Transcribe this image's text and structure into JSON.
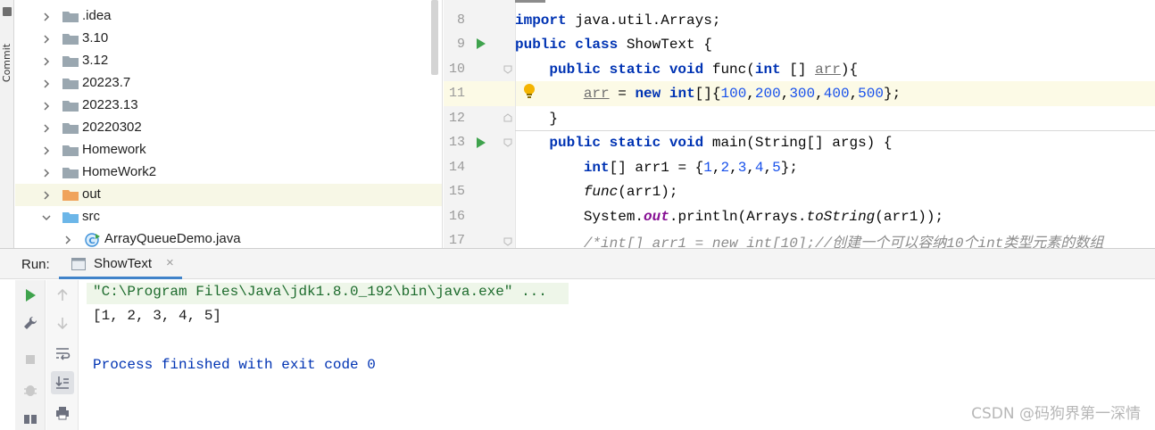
{
  "sidebar_strip": {
    "label": "Commit"
  },
  "project_tree": {
    "items": [
      {
        "label": ".idea",
        "type": "folder",
        "expanded": false
      },
      {
        "label": "3.10",
        "type": "folder",
        "expanded": false
      },
      {
        "label": "3.12",
        "type": "folder",
        "expanded": false
      },
      {
        "label": "20223.7",
        "type": "folder",
        "expanded": false
      },
      {
        "label": "20223.13",
        "type": "folder",
        "expanded": false
      },
      {
        "label": "20220302",
        "type": "folder",
        "expanded": false
      },
      {
        "label": "Homework",
        "type": "folder",
        "expanded": false
      },
      {
        "label": "HomeWork2",
        "type": "folder",
        "expanded": false
      },
      {
        "label": "out",
        "type": "folder-excluded",
        "expanded": false,
        "selected": true
      },
      {
        "label": "src",
        "type": "source-folder",
        "expanded": true
      },
      {
        "label": "ArrayQueueDemo.java",
        "type": "java-class",
        "expanded": false
      }
    ]
  },
  "editor": {
    "line_numbers": [
      "8",
      "9",
      "10",
      "11",
      "12",
      "13",
      "14",
      "15",
      "16",
      "17"
    ],
    "lines": {
      "l8": {
        "kw1": "import",
        "rest": " java.util.Arrays;"
      },
      "l9": {
        "kw1": "public class",
        "rest": " ShowText {"
      },
      "l10": {
        "indent": "    ",
        "kw1": "public static void",
        "mid": " func(",
        "kw2": "int",
        "mid2": " [] ",
        "param": "arr",
        "end": "){"
      },
      "l11": {
        "indent": "        ",
        "var": "arr",
        "eq": " = ",
        "kw1": "new",
        "sp": " ",
        "kw2": "int",
        "br": "[]{",
        "n1": "100",
        "n2": "200",
        "n3": "300",
        "n4": "400",
        "n5": "500",
        "close": "};",
        "comma": ","
      },
      "l12": {
        "indent": "    ",
        "text": "}"
      },
      "l13": {
        "indent": "    ",
        "kw1": "public static void",
        "rest": " main(String[] args) {"
      },
      "l14": {
        "indent": "        ",
        "kw1": "int",
        "mid": "[] arr1 = {",
        "n1": "1",
        "n2": "2",
        "n3": "3",
        "n4": "4",
        "n5": "5",
        "close": "};",
        "comma": ","
      },
      "l15": {
        "indent": "        ",
        "fn": "func",
        "rest": "(arr1);"
      },
      "l16": {
        "indent": "        ",
        "pre": "System.",
        "field": "out",
        "mid": ".println(Arrays.",
        "fn": "toString",
        "rest": "(arr1));"
      },
      "l17": {
        "indent": "        ",
        "comment": "/*int[] arr1 = new int[10];//创建一个可以容纳10个int类型元素的数组"
      }
    }
  },
  "run_panel": {
    "title": "Run:",
    "tab_label": "ShowText",
    "tab_close": "×",
    "console": {
      "command": "\"C:\\Program Files\\Java\\jdk1.8.0_192\\bin\\java.exe\" ...",
      "output": "[1, 2, 3, 4, 5]",
      "exit": "Process finished with exit code 0"
    }
  },
  "watermark": "CSDN @码狗界第一深情",
  "colors": {
    "keyword": "#0033b3",
    "number": "#1750eb",
    "static_field": "#871094",
    "comment": "#8c8c8c",
    "run_green": "#3fa34d",
    "console_cmd": "#1d6b2d",
    "folder": "#9aa7b0",
    "excluded_folder": "#f0a35b",
    "source_folder": "#6cb6e8",
    "bulb": "#f4b400"
  },
  "icons": [
    "run-icon",
    "folder-icon",
    "java-class-icon",
    "intention-bulb-icon",
    "rerun-icon",
    "wrench-icon",
    "stop-icon",
    "up-arrow-icon",
    "down-arrow-icon",
    "soft-wrap-icon",
    "scroll-to-end-icon",
    "print-icon",
    "layout-icon",
    "debug-icon"
  ]
}
